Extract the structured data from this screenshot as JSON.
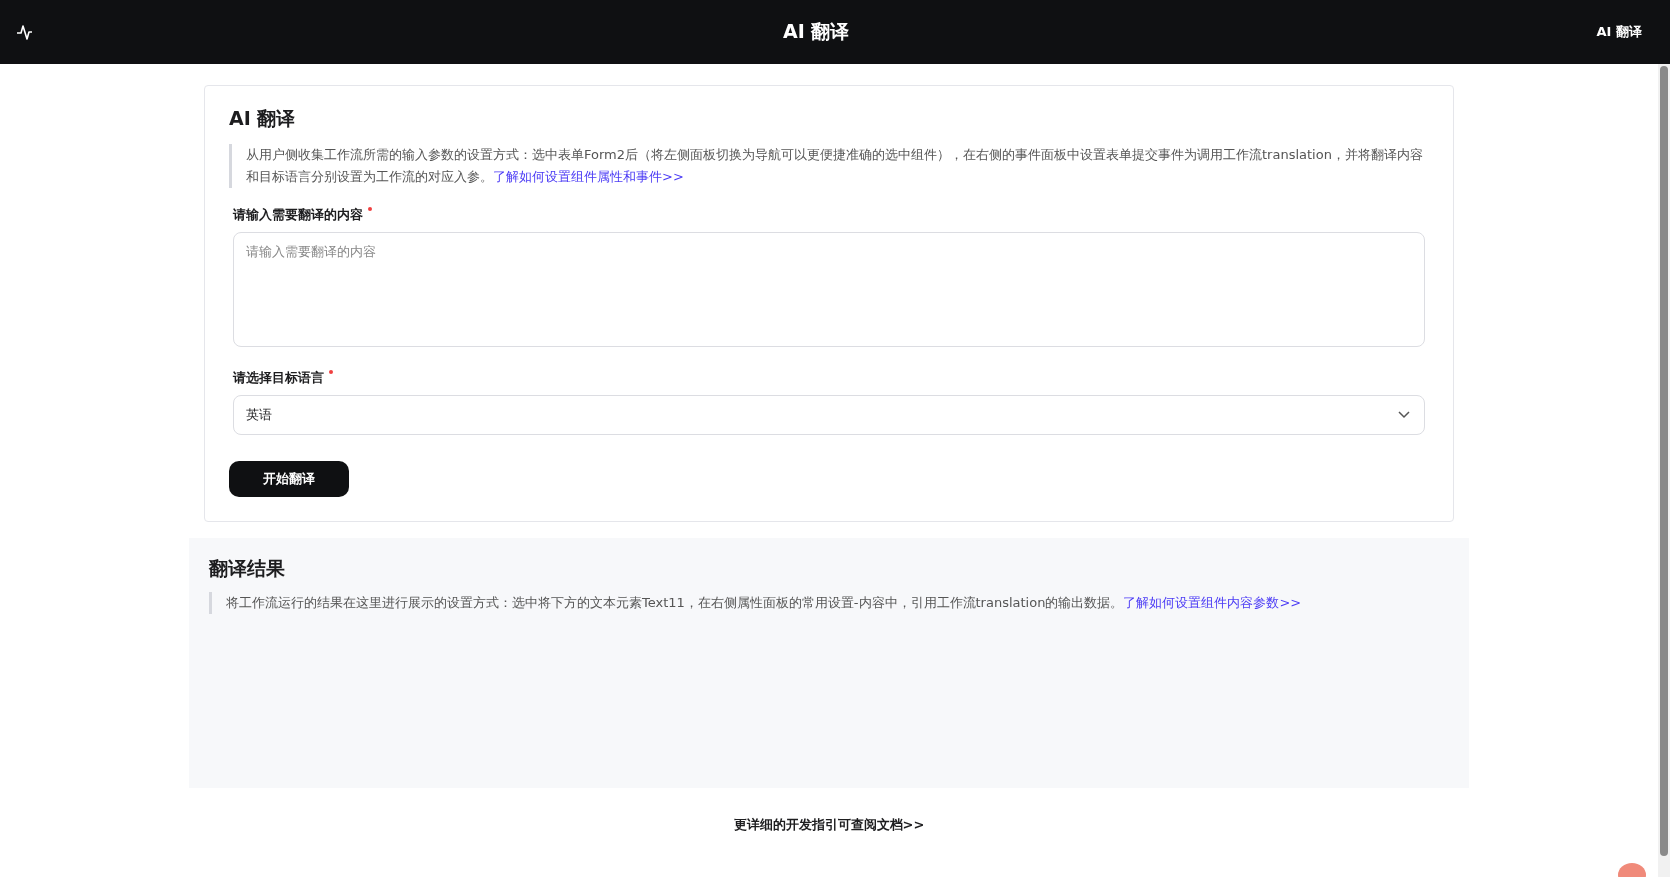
{
  "header": {
    "title": "AI 翻译",
    "right_label": "AI 翻译"
  },
  "form_card": {
    "title": "AI 翻译",
    "description": "从用户侧收集工作流所需的输入参数的设置方式：选中表单Form2后（将左侧面板切换为导航可以更便捷准确的选中组件），在右侧的事件面板中设置表单提交事件为调用工作流translation，并将翻译内容和目标语言分别设置为工作流的对应入参。",
    "link": "了解如何设置组件属性和事件>>",
    "fields": [
      {
        "kind": "textarea",
        "label": "请输入需要翻译的内容",
        "required": true,
        "placeholder": "请输入需要翻译的内容"
      },
      {
        "kind": "select",
        "label": "请选择目标语言",
        "required": true,
        "value": "英语"
      }
    ],
    "submit_button": "开始翻译"
  },
  "result_panel": {
    "title": "翻译结果",
    "description": "将工作流运行的结果在这里进行展示的设置方式：选中将下方的文本元素Text11，在右侧属性面板的常用设置-内容中，引用工作流translation的输出数据。",
    "link": "了解如何设置组件内容参数>>"
  },
  "footer_link": "更详细的开发指引可查阅文档>>"
}
